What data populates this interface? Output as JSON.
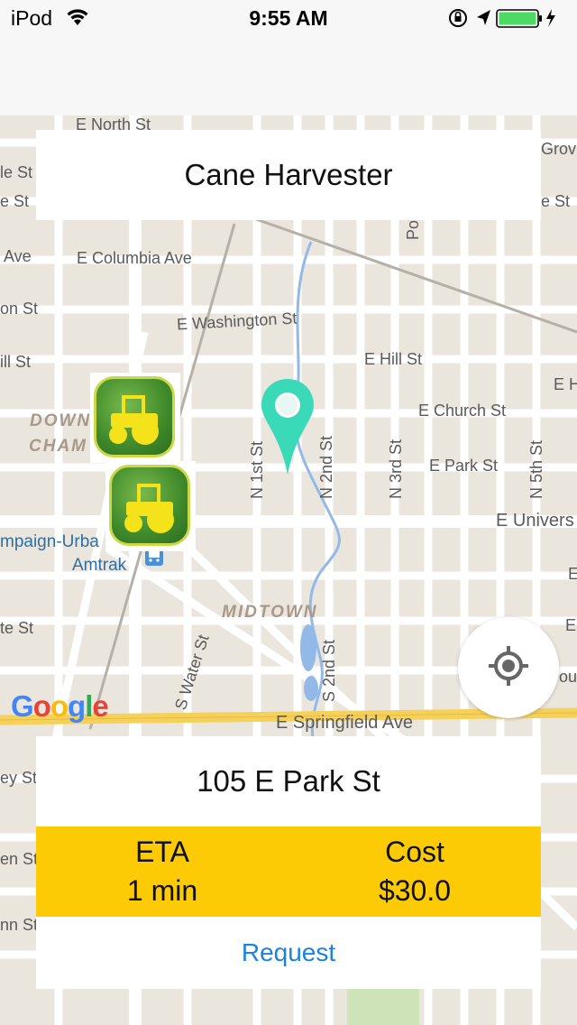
{
  "status_bar": {
    "carrier": "iPod",
    "time": "9:55 AM"
  },
  "map": {
    "streets": {
      "e_north": "E North St",
      "le_st": "le St",
      "e_st": "e St",
      "ave": "Ave",
      "e_columbia": "E Columbia Ave",
      "on_st": "on St",
      "e_washington": "E Washington St",
      "ill_st": "ill St",
      "e_hill": "E Hill St",
      "e_church": "E Church St",
      "e_park": "E Park St",
      "e_h": "E H",
      "e_univers": "E Univers",
      "n_1st": "N 1st St",
      "n_2nd": "N 2nd St",
      "n_3rd": "N 3rd St",
      "n_5th": "N 5th St",
      "po": "Po",
      "grov": "Grov",
      "e_st_right": "e St",
      "te_st": "te St",
      "s_water": "S Water St",
      "s_2nd": "S 2nd St",
      "e_springfield": "E Springfield Ave",
      "ey_st": "ey St",
      "en_st": "en St",
      "nn_st": "nn St",
      "e_r1": "E",
      "e_r2": "E",
      "ou": "ou"
    },
    "districts": {
      "downtown_1": "DOWN",
      "downtown_2": "CHAM",
      "midtown": "MIDTOWN"
    },
    "pois": {
      "champaign_urbana": "mpaign-Urba",
      "amtrak": "Amtrak"
    },
    "logo": "Google",
    "colors": {
      "water": "#93b9e8",
      "highway": "#f5d15a",
      "pin": "#3ad9b8"
    }
  },
  "top_card": {
    "title": "Cane Harvester"
  },
  "bottom_card": {
    "address": "105 E Park St",
    "eta_label": "ETA",
    "eta_value": "1 min",
    "cost_label": "Cost",
    "cost_value": "$30.0",
    "request_label": "Request",
    "accent": "#fccb06"
  },
  "icons": [
    "wifi-icon",
    "lock-rotation-icon",
    "location-arrow-icon",
    "battery-icon",
    "charging-icon",
    "tractor-icon",
    "map-pin-icon",
    "my-location-icon"
  ]
}
